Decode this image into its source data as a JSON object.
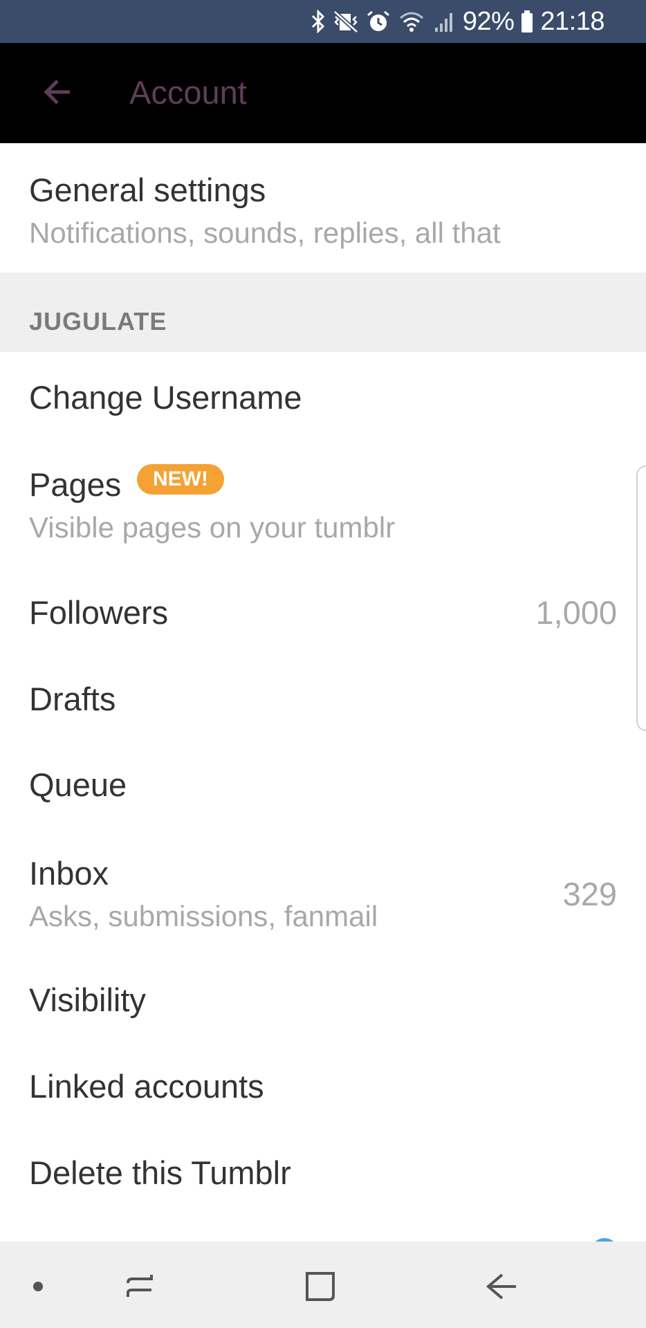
{
  "status_bar": {
    "battery": "92%",
    "time": "21:18",
    "icons": [
      "bluetooth-icon",
      "vibrate-icon",
      "alarm-icon",
      "wifi-icon",
      "signal-icon",
      "battery-icon"
    ]
  },
  "app_bar": {
    "title": "Account",
    "back_icon": "arrow-left-icon",
    "accent": "#5f3e5a"
  },
  "general": {
    "title": "General settings",
    "subtitle": "Notifications, sounds, replies, all that"
  },
  "section": {
    "header": "JUGULATE"
  },
  "items": {
    "change_username": {
      "title": "Change Username"
    },
    "pages": {
      "title": "Pages",
      "badge": "NEW!",
      "subtitle": "Visible pages on your tumblr"
    },
    "followers": {
      "title": "Followers",
      "value": "1,000"
    },
    "drafts": {
      "title": "Drafts"
    },
    "queue": {
      "title": "Queue"
    },
    "inbox": {
      "title": "Inbox",
      "subtitle": "Asks, submissions, fanmail",
      "value": "329"
    },
    "visibility": {
      "title": "Visibility"
    },
    "linked_accounts": {
      "title": "Linked accounts"
    },
    "delete": {
      "title": "Delete this Tumblr"
    }
  },
  "colors": {
    "status_bar": "#3a4c6a",
    "badge": "#f4a233",
    "section_bg": "#efefef"
  },
  "nav_bar": {
    "icons": [
      "dot-icon",
      "recent-apps-icon",
      "home-icon",
      "back-icon"
    ]
  }
}
